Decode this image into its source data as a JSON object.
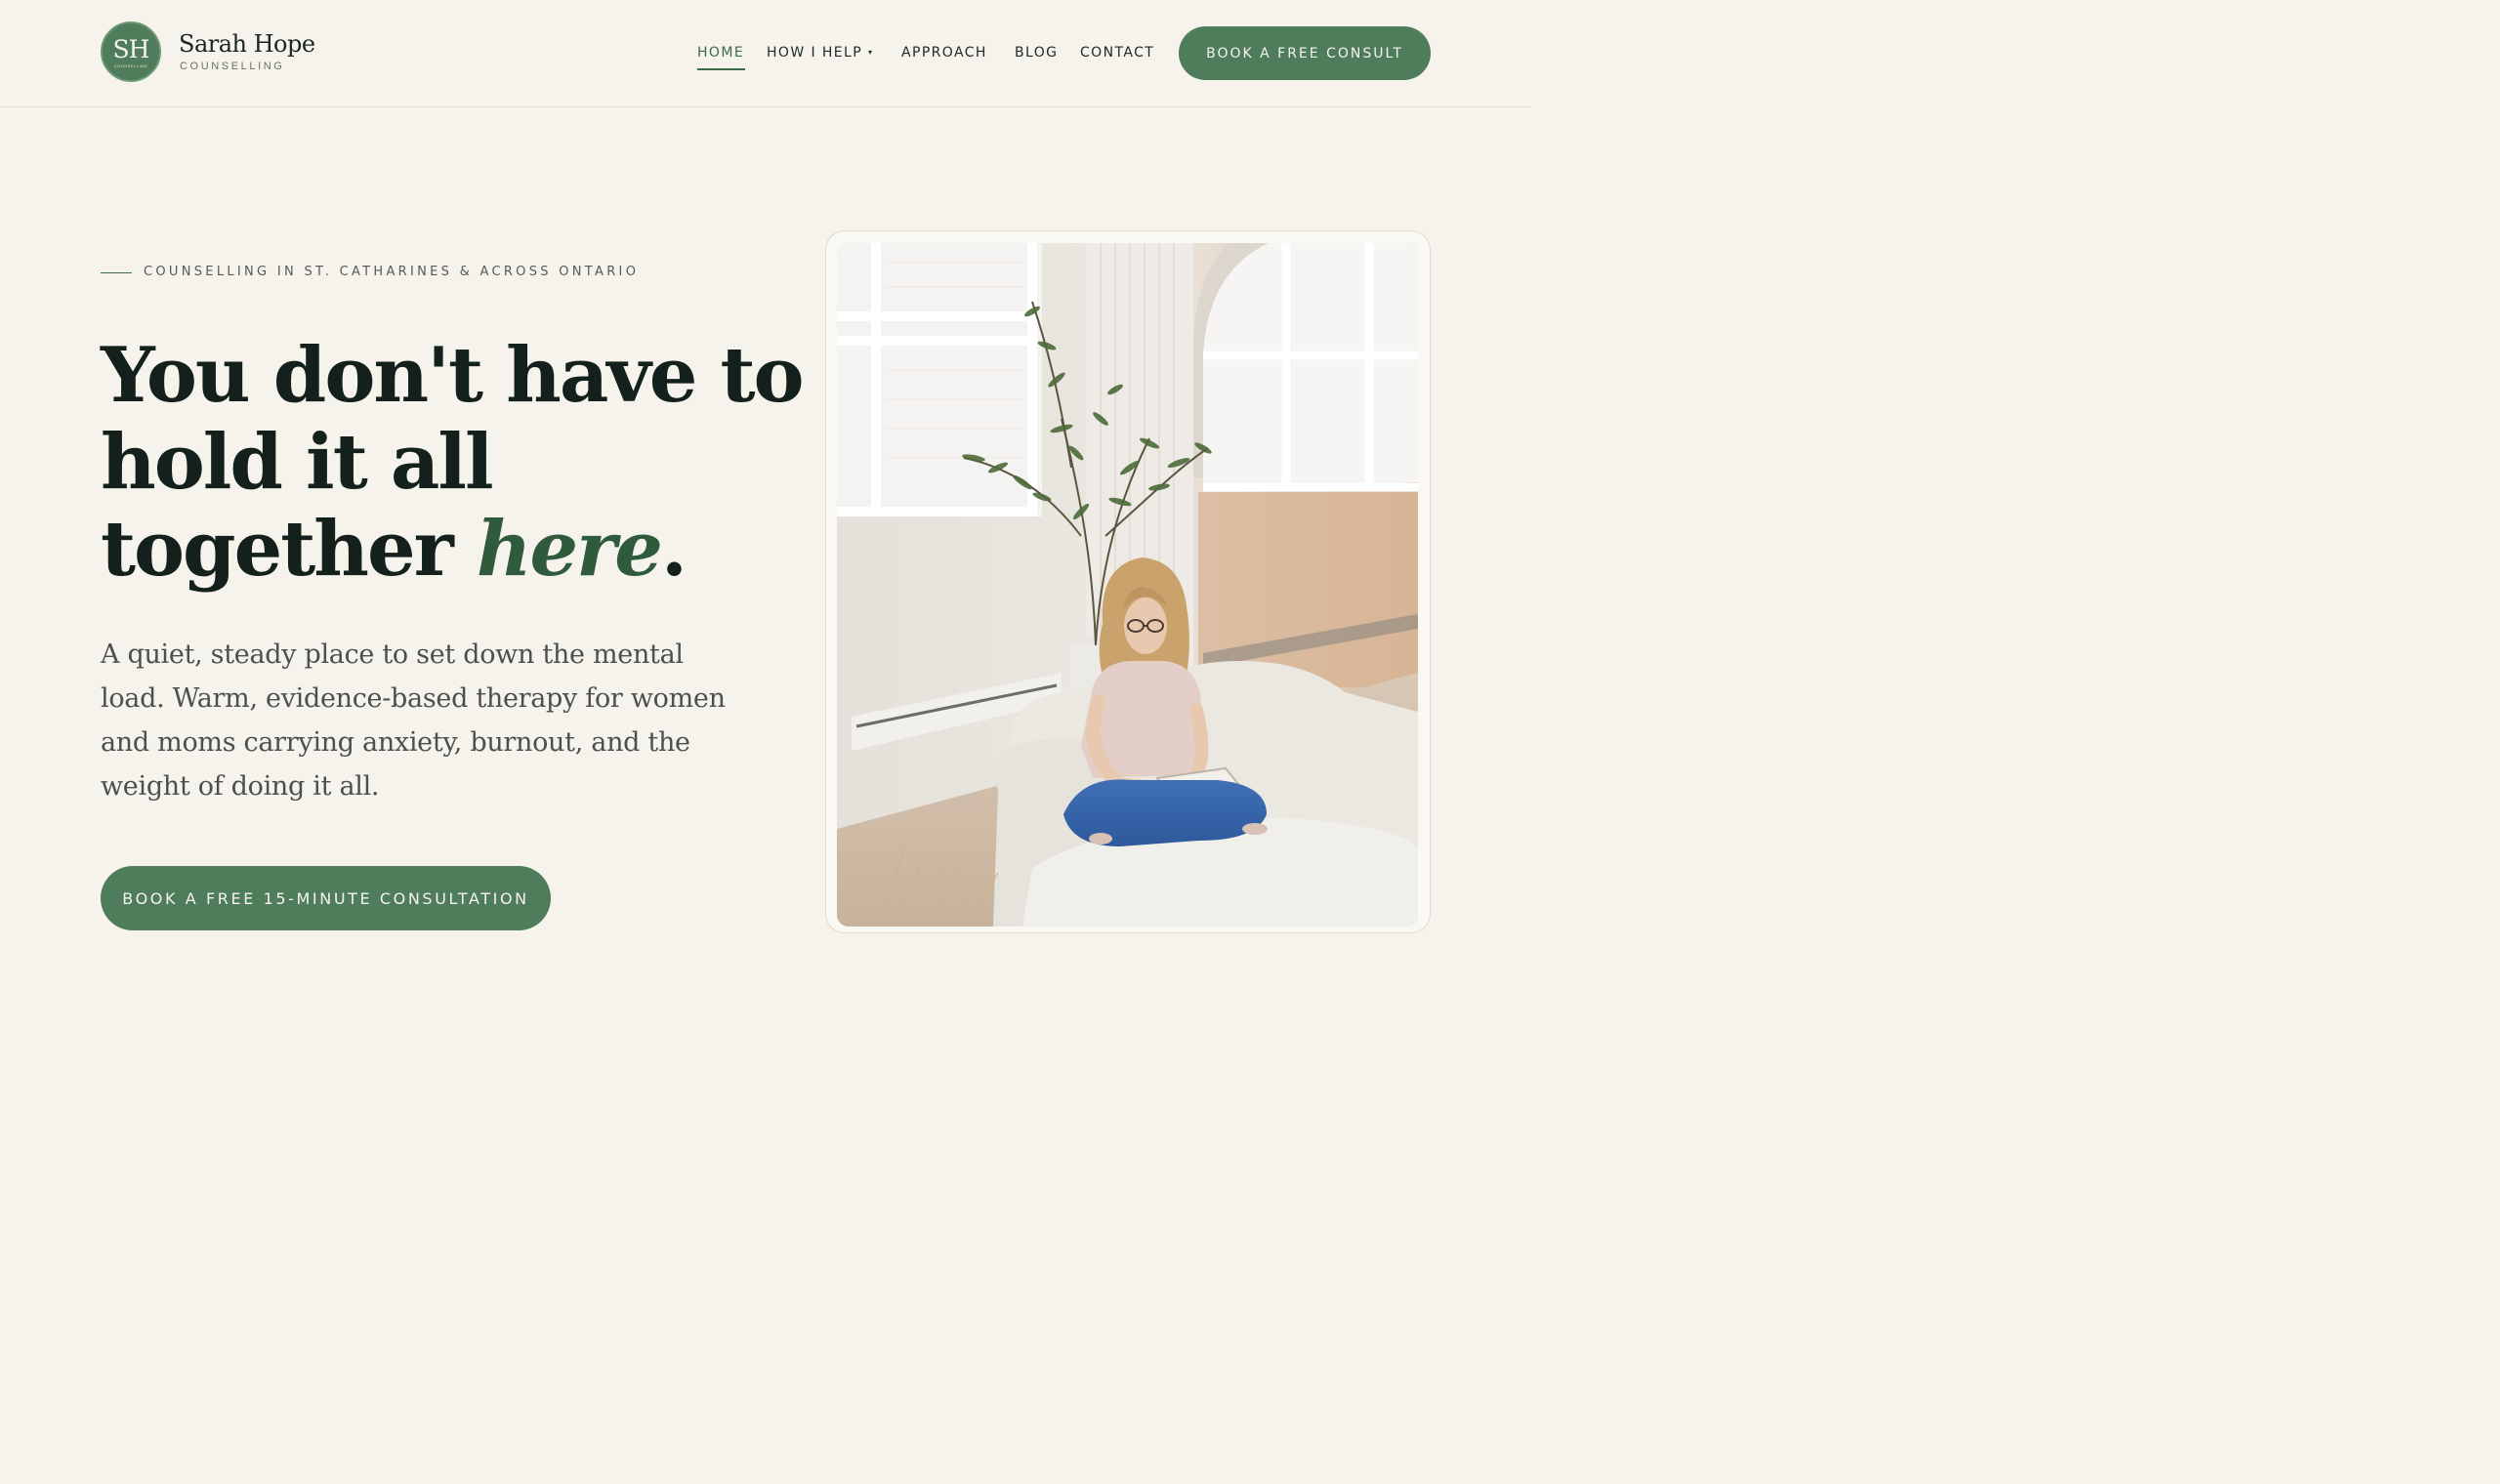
{
  "brand": {
    "initials": "SH",
    "mark_sub": "COUNSELLING",
    "name": "Sarah Hope",
    "tagline": "COUNSELLING"
  },
  "nav": {
    "items": [
      {
        "label": "HOME",
        "active": true
      },
      {
        "label": "HOW I HELP",
        "has_dropdown": true
      },
      {
        "label": "APPROACH"
      },
      {
        "label": "BLOG"
      },
      {
        "label": "CONTACT"
      }
    ],
    "dropdown_caret": "▾",
    "cta_label": "BOOK A FREE CONSULT"
  },
  "hero": {
    "eyebrow": "COUNSELLING IN ST. CATHARINES & ACROSS ONTARIO",
    "headline_line1": "You don't have to",
    "headline_line2": "hold it all",
    "headline_line3_start": "together ",
    "headline_emphasis": "here",
    "headline_end": ".",
    "lede": "A quiet, steady place to set down the mental load. Warm, evidence-based therapy for women and moms carrying anxiety, burnout, and the weight of doing it all.",
    "cta_label": "BOOK A FREE 15-MINUTE CONSULTATION",
    "photo_subject": "therapist-seated-on-sofa-reading"
  },
  "colors": {
    "background": "#f5f3eb",
    "brand_green": "#4f7c5a",
    "accent_text": "#2f5a3c",
    "heading": "#13201b",
    "body_text": "#4a514c"
  }
}
